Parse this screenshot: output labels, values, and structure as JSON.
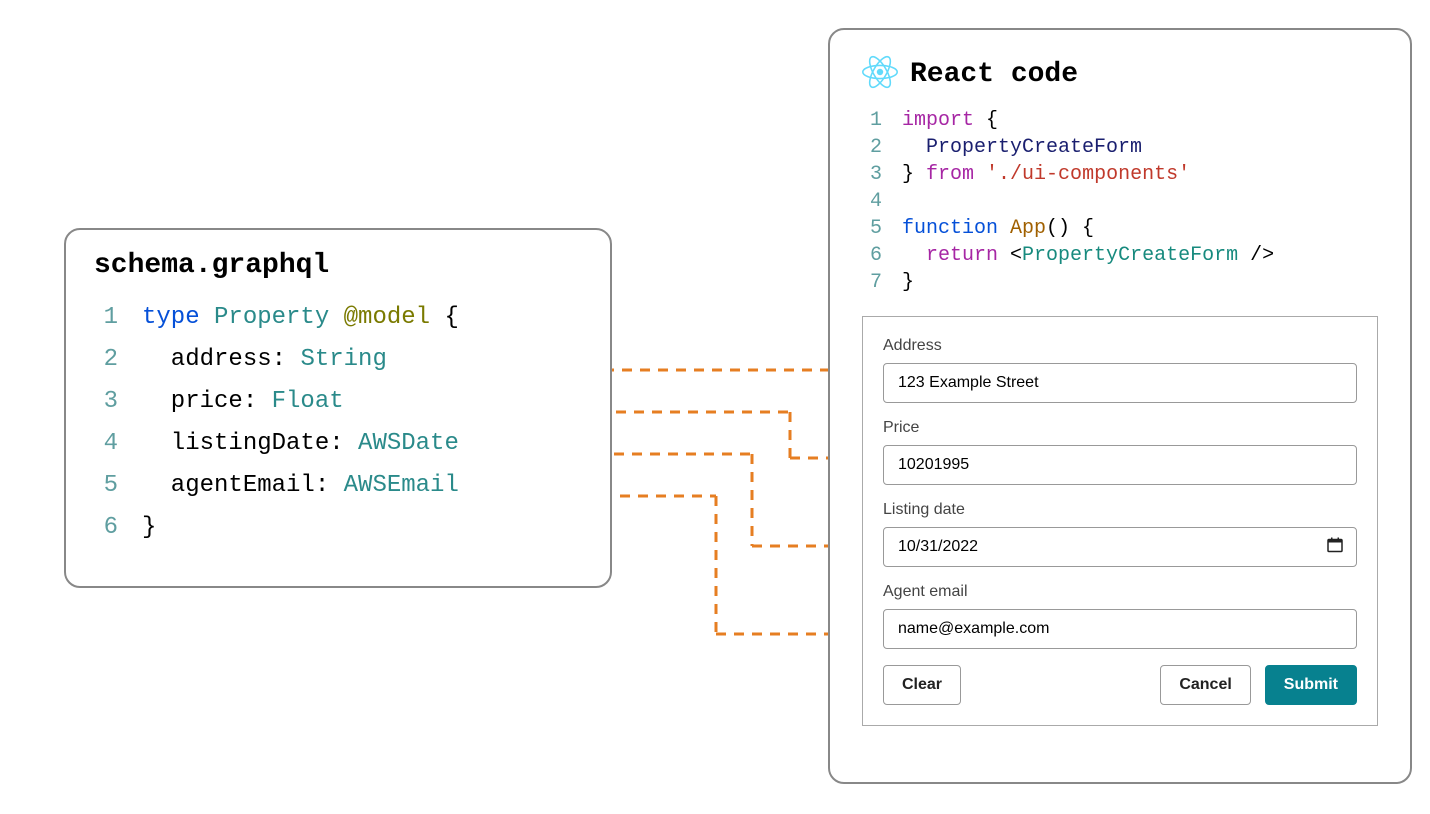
{
  "schema": {
    "title": "schema.graphql",
    "lines": [
      {
        "num": "1",
        "tokens": [
          [
            "kw-blue",
            "type "
          ],
          [
            "kw-teal",
            "Property "
          ],
          [
            "kw-olive",
            "@model"
          ],
          [
            "",
            " {"
          ]
        ]
      },
      {
        "num": "2",
        "tokens": [
          [
            "",
            "  address: "
          ],
          [
            "kw-teal",
            "String"
          ]
        ]
      },
      {
        "num": "3",
        "tokens": [
          [
            "",
            "  price: "
          ],
          [
            "kw-teal",
            "Float"
          ]
        ]
      },
      {
        "num": "4",
        "tokens": [
          [
            "",
            "  listingDate: "
          ],
          [
            "kw-teal",
            "AWSDate"
          ]
        ]
      },
      {
        "num": "5",
        "tokens": [
          [
            "",
            "  agentEmail: "
          ],
          [
            "kw-teal",
            "AWSEmail"
          ]
        ]
      },
      {
        "num": "6",
        "tokens": [
          [
            "",
            "}"
          ]
        ]
      }
    ]
  },
  "react": {
    "title": "React code",
    "lines": [
      {
        "num": "1",
        "tokens": [
          [
            "kw-purple",
            "import"
          ],
          [
            "",
            " {"
          ]
        ]
      },
      {
        "num": "2",
        "tokens": [
          [
            "",
            "  "
          ],
          [
            "kw-navy",
            "PropertyCreateForm"
          ]
        ]
      },
      {
        "num": "3",
        "tokens": [
          [
            "",
            "} "
          ],
          [
            "kw-purple",
            "from"
          ],
          [
            "",
            " "
          ],
          [
            "kw-red",
            "'./ui-components'"
          ]
        ]
      },
      {
        "num": "4",
        "tokens": [
          [
            "",
            ""
          ]
        ]
      },
      {
        "num": "5",
        "tokens": [
          [
            "kw-blue",
            "function "
          ],
          [
            "kw-orange",
            "App"
          ],
          [
            "",
            "() {"
          ]
        ]
      },
      {
        "num": "6",
        "tokens": [
          [
            "",
            "  "
          ],
          [
            "kw-purple",
            "return"
          ],
          [
            "",
            " <"
          ],
          [
            "kw-teal2",
            "PropertyCreateForm"
          ],
          [
            "",
            " />"
          ]
        ]
      },
      {
        "num": "7",
        "tokens": [
          [
            "",
            "}"
          ]
        ]
      }
    ]
  },
  "form": {
    "fields": {
      "address": {
        "label": "Address",
        "value": "123 Example Street"
      },
      "price": {
        "label": "Price",
        "value": "10201995"
      },
      "listing_date": {
        "label": "Listing date",
        "value": "10/31/2022"
      },
      "agent_email": {
        "label": "Agent email",
        "value": "name@example.com"
      }
    },
    "buttons": {
      "clear": "Clear",
      "cancel": "Cancel",
      "submit": "Submit"
    }
  },
  "colors": {
    "connector": "#e67e22",
    "primary_button": "#07818f"
  }
}
